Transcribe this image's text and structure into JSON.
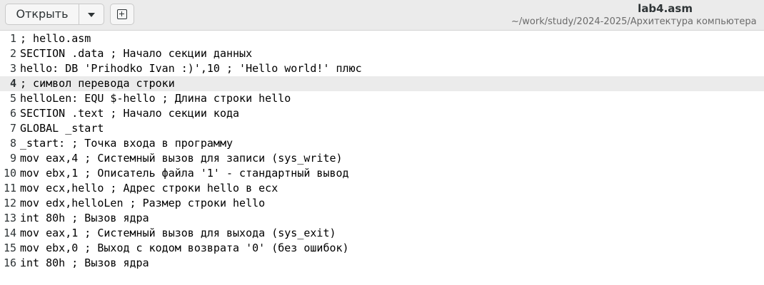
{
  "header": {
    "open_label": "Открыть",
    "title": "lab4.asm",
    "subtitle": "~/work/study/2024-2025/Архитектура компьютера"
  },
  "editor": {
    "current_line": 4,
    "lines": [
      {
        "num": "1",
        "text": "; hello.asm"
      },
      {
        "num": "2",
        "text": "SECTION .data ; Начало секции данных"
      },
      {
        "num": "3",
        "text": "hello: DB 'Prihodko Ivan :)',10 ; 'Hello world!' плюс"
      },
      {
        "num": "4",
        "text": "; символ перевода строки"
      },
      {
        "num": "5",
        "text": "helloLen: EQU $-hello ; Длина строки hello"
      },
      {
        "num": "6",
        "text": "SECTION .text ; Начало секции кода"
      },
      {
        "num": "7",
        "text": "GLOBAL _start"
      },
      {
        "num": "8",
        "text": "_start: ; Точка входа в программу"
      },
      {
        "num": "9",
        "text": "mov eax,4 ; Системный вызов для записи (sys_write)"
      },
      {
        "num": "10",
        "text": "mov ebx,1 ; Описатель файла '1' - стандартный вывод"
      },
      {
        "num": "11",
        "text": "mov ecx,hello ; Адрес строки hello в ecx"
      },
      {
        "num": "12",
        "text": "mov edx,helloLen ; Размер строки hello"
      },
      {
        "num": "13",
        "text": "int 80h ; Вызов ядра"
      },
      {
        "num": "14",
        "text": "mov eax,1 ; Системный вызов для выхода (sys_exit)"
      },
      {
        "num": "15",
        "text": "mov ebx,0 ; Выход с кодом возврата '0' (без ошибок)"
      },
      {
        "num": "16",
        "text": "int 80h ; Вызов ядра"
      }
    ]
  }
}
